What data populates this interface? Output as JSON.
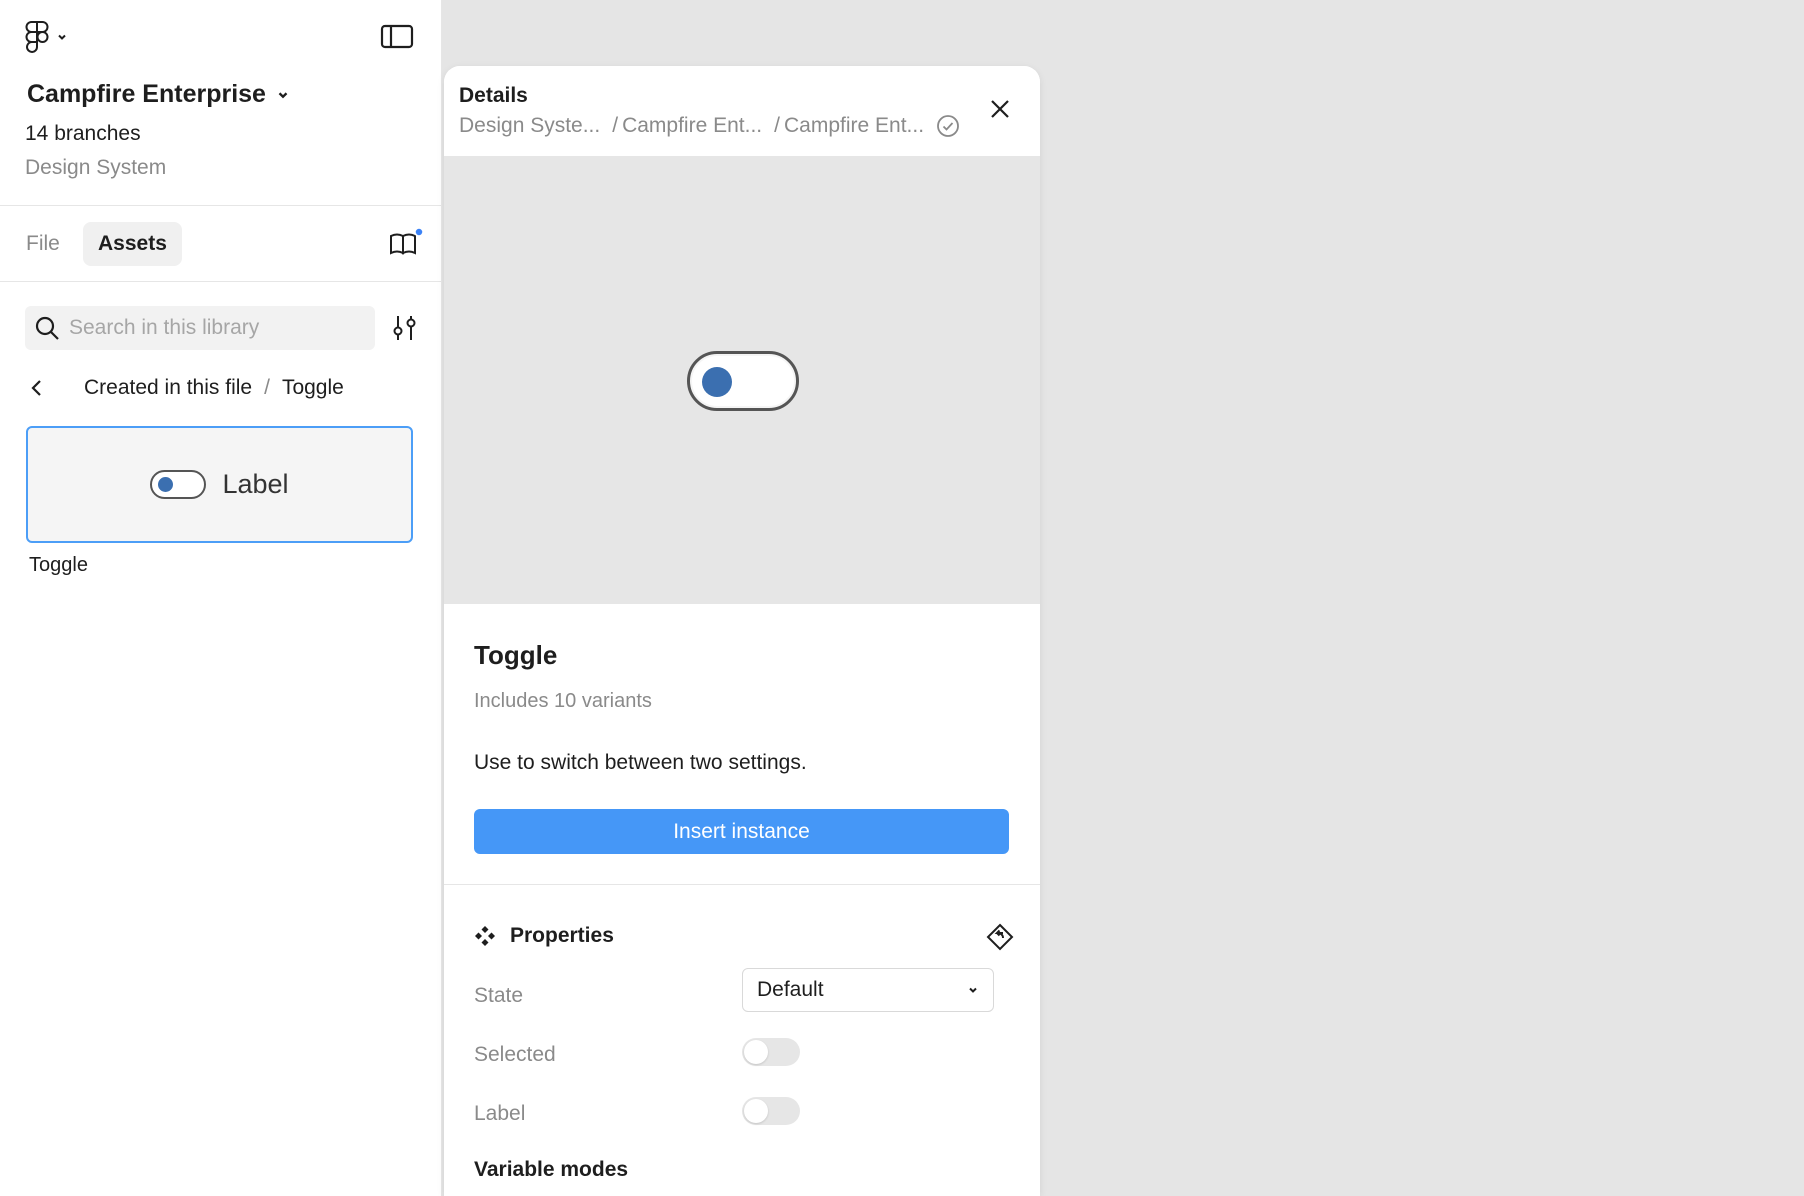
{
  "sidebar": {
    "project_title": "Campfire Enterprise",
    "branches": "14 branches",
    "team": "Design System",
    "tabs": [
      {
        "label": "File",
        "active": false
      },
      {
        "label": "Assets",
        "active": true
      }
    ],
    "search": {
      "placeholder": "Search in this library",
      "value": ""
    },
    "breadcrumb": {
      "parent": "Created in this file",
      "separator": "/",
      "current": "Toggle"
    },
    "asset": {
      "preview_label": "Label",
      "name": "Toggle"
    }
  },
  "details": {
    "title": "Details",
    "path": [
      "Design Syste...",
      "Campfire Ent...",
      "Campfire Ent..."
    ],
    "path_separator": "/",
    "component": {
      "name": "Toggle",
      "variants": "Includes 10 variants",
      "description": "Use to switch between two settings."
    },
    "insert_label": "Insert instance",
    "properties": {
      "heading": "Properties",
      "state": {
        "label": "State",
        "value": "Default"
      },
      "selected": {
        "label": "Selected",
        "on": false
      },
      "label": {
        "label": "Label",
        "on": false
      }
    },
    "variable_modes": "Variable modes"
  },
  "colors": {
    "accent": "#4597f7",
    "selection_border": "#4c9ef7",
    "toggle_knob": "#3b6fb0",
    "notification_dot": "#3b82f6"
  },
  "icons": {
    "logo": "figma-logo-icon",
    "sidebar_toggle": "sidebar-panel-icon",
    "library": "book-icon",
    "search": "search-icon",
    "filter": "sliders-icon",
    "back": "chevron-left-icon",
    "verified": "check-circle-icon",
    "close": "close-icon",
    "component": "component-icon",
    "reset": "reset-instance-icon"
  }
}
